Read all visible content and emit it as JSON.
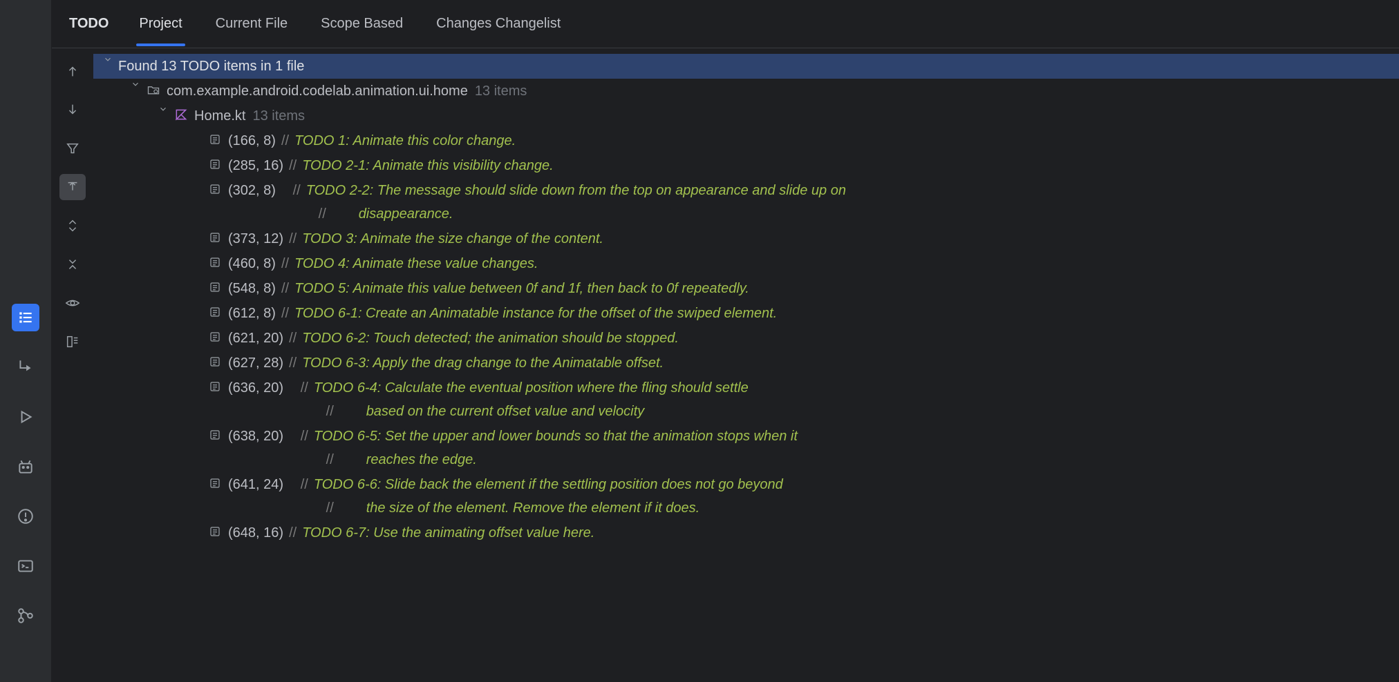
{
  "panel_title": "TODO",
  "tabs": [
    {
      "label": "Project",
      "active": true
    },
    {
      "label": "Current File",
      "active": false
    },
    {
      "label": "Scope Based",
      "active": false
    },
    {
      "label": "Changes Changelist",
      "active": false
    }
  ],
  "summary": "Found 13 TODO items in 1 file",
  "package_name": "com.example.android.codelab.animation.ui.home",
  "package_count": "13 items",
  "file_name": "Home.kt",
  "file_count": "13 items",
  "items": [
    {
      "loc": "(166, 8)",
      "prefix": "//",
      "text": "TODO 1: Animate this color change."
    },
    {
      "loc": "(285, 16)",
      "prefix": "//",
      "text": "TODO 2-1: Animate this visibility change."
    },
    {
      "loc": "(302, 8)",
      "prefix": "//",
      "text": "TODO 2-2: The message should slide down from the top on appearance and slide up on",
      "cont_prefix": "//",
      "cont": "disappearance.",
      "padded": true
    },
    {
      "loc": "(373, 12)",
      "prefix": "//",
      "text": "TODO 3: Animate the size change of the content."
    },
    {
      "loc": "(460, 8)",
      "prefix": "//",
      "text": "TODO 4: Animate these value changes."
    },
    {
      "loc": "(548, 8)",
      "prefix": "//",
      "text": "TODO 5: Animate this value between 0f and 1f, then back to 0f repeatedly."
    },
    {
      "loc": "(612, 8)",
      "prefix": "//",
      "text": "TODO 6-1: Create an Animatable instance for the offset of the swiped element."
    },
    {
      "loc": "(621, 20)",
      "prefix": "//",
      "text": "TODO 6-2: Touch detected; the animation should be stopped."
    },
    {
      "loc": "(627, 28)",
      "prefix": "//",
      "text": "TODO 6-3: Apply the drag change to the Animatable offset."
    },
    {
      "loc": "(636, 20)",
      "prefix": "//",
      "text": "TODO 6-4: Calculate the eventual position where the fling should settle",
      "cont_prefix": "//",
      "cont": "based on the current offset value and velocity",
      "padded": true
    },
    {
      "loc": "(638, 20)",
      "prefix": "//",
      "text": "TODO 6-5: Set the upper and lower bounds so that the animation stops when it",
      "cont_prefix": "//",
      "cont": "reaches the edge.",
      "padded": true
    },
    {
      "loc": "(641, 24)",
      "prefix": "//",
      "text": "TODO 6-6: Slide back the element if the settling position does not go beyond",
      "cont_prefix": "//",
      "cont": "the size of the element. Remove the element if it does.",
      "padded": true
    },
    {
      "loc": "(648, 16)",
      "prefix": "//",
      "text": "TODO 6-7: Use the animating offset value here."
    }
  ]
}
